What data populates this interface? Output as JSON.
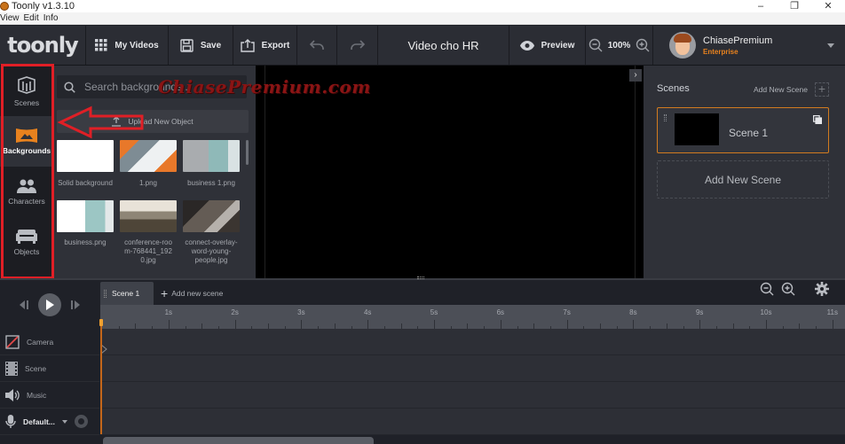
{
  "window": {
    "title": "Toonly v1.3.10",
    "controls": [
      "minimize",
      "restore",
      "close"
    ]
  },
  "menubar": [
    "View",
    "Edit",
    "Info"
  ],
  "toolbar": {
    "logo": "toonly",
    "my_videos": "My Videos",
    "save": "Save",
    "export": "Export",
    "project_title": "Video cho HR",
    "preview": "Preview",
    "zoom_level": "100%",
    "user_name": "ChiasePremium",
    "user_plan": "Enterprise"
  },
  "leftnav": {
    "items": [
      {
        "label": "Scenes",
        "icon": "scenes-cube-icon",
        "active": false
      },
      {
        "label": "Backgrounds",
        "icon": "mountain-banner-icon",
        "active": true
      },
      {
        "label": "Characters",
        "icon": "people-icon",
        "active": false
      },
      {
        "label": "Objects",
        "icon": "sofa-icon",
        "active": false
      }
    ]
  },
  "assets": {
    "search_placeholder": "Search backgrounds...",
    "upload_label": "Upload New Object",
    "items": [
      {
        "label": "Solid background"
      },
      {
        "label": "1.png"
      },
      {
        "label": "business 1.png"
      },
      {
        "label": "business.png"
      },
      {
        "label": "conference-room-768441_1920.jpg"
      },
      {
        "label": "connect-overlay-word-young-people.jpg"
      }
    ]
  },
  "watermark": "ChiasePremium.com",
  "scenes_panel": {
    "title": "Scenes",
    "add_label": "Add New Scene",
    "scenes": [
      {
        "name": "Scene 1",
        "selected": true
      }
    ],
    "add_box_label": "Add New Scene"
  },
  "timeline": {
    "tabs": [
      {
        "label": "Scene 1",
        "active": true
      }
    ],
    "add_scene": "Add new scene",
    "ruler_labels": [
      "1s",
      "2s",
      "3s",
      "4s",
      "5s",
      "6s",
      "7s",
      "8s",
      "9s",
      "10s",
      "11s"
    ],
    "tracks": [
      {
        "label": "Camera",
        "icon": "camera-icon"
      },
      {
        "label": "Scene",
        "icon": "film-icon"
      },
      {
        "label": "Music",
        "icon": "speaker-icon"
      },
      {
        "label": "Default...",
        "icon": "microphone-icon"
      }
    ]
  },
  "colors": {
    "accent": "#e8821e",
    "highlight_box": "#e01f26",
    "background": "#1f2128"
  }
}
